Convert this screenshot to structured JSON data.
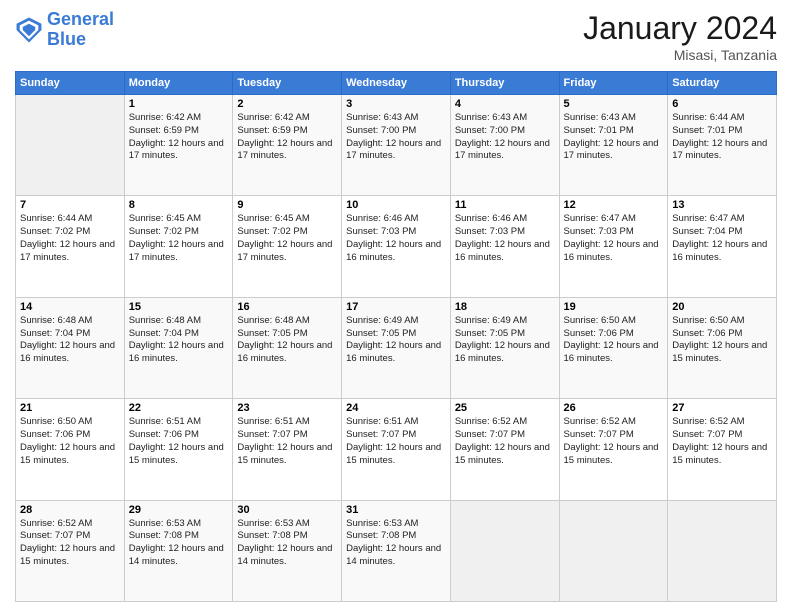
{
  "header": {
    "logo_line1": "General",
    "logo_line2": "Blue",
    "month_title": "January 2024",
    "location": "Misasi, Tanzania"
  },
  "weekdays": [
    "Sunday",
    "Monday",
    "Tuesday",
    "Wednesday",
    "Thursday",
    "Friday",
    "Saturday"
  ],
  "weeks": [
    [
      {
        "day": "",
        "sunrise": "",
        "sunset": "",
        "daylight": ""
      },
      {
        "day": "1",
        "sunrise": "Sunrise: 6:42 AM",
        "sunset": "Sunset: 6:59 PM",
        "daylight": "Daylight: 12 hours and 17 minutes."
      },
      {
        "day": "2",
        "sunrise": "Sunrise: 6:42 AM",
        "sunset": "Sunset: 6:59 PM",
        "daylight": "Daylight: 12 hours and 17 minutes."
      },
      {
        "day": "3",
        "sunrise": "Sunrise: 6:43 AM",
        "sunset": "Sunset: 7:00 PM",
        "daylight": "Daylight: 12 hours and 17 minutes."
      },
      {
        "day": "4",
        "sunrise": "Sunrise: 6:43 AM",
        "sunset": "Sunset: 7:00 PM",
        "daylight": "Daylight: 12 hours and 17 minutes."
      },
      {
        "day": "5",
        "sunrise": "Sunrise: 6:43 AM",
        "sunset": "Sunset: 7:01 PM",
        "daylight": "Daylight: 12 hours and 17 minutes."
      },
      {
        "day": "6",
        "sunrise": "Sunrise: 6:44 AM",
        "sunset": "Sunset: 7:01 PM",
        "daylight": "Daylight: 12 hours and 17 minutes."
      }
    ],
    [
      {
        "day": "7",
        "sunrise": "Sunrise: 6:44 AM",
        "sunset": "Sunset: 7:02 PM",
        "daylight": "Daylight: 12 hours and 17 minutes."
      },
      {
        "day": "8",
        "sunrise": "Sunrise: 6:45 AM",
        "sunset": "Sunset: 7:02 PM",
        "daylight": "Daylight: 12 hours and 17 minutes."
      },
      {
        "day": "9",
        "sunrise": "Sunrise: 6:45 AM",
        "sunset": "Sunset: 7:02 PM",
        "daylight": "Daylight: 12 hours and 17 minutes."
      },
      {
        "day": "10",
        "sunrise": "Sunrise: 6:46 AM",
        "sunset": "Sunset: 7:03 PM",
        "daylight": "Daylight: 12 hours and 16 minutes."
      },
      {
        "day": "11",
        "sunrise": "Sunrise: 6:46 AM",
        "sunset": "Sunset: 7:03 PM",
        "daylight": "Daylight: 12 hours and 16 minutes."
      },
      {
        "day": "12",
        "sunrise": "Sunrise: 6:47 AM",
        "sunset": "Sunset: 7:03 PM",
        "daylight": "Daylight: 12 hours and 16 minutes."
      },
      {
        "day": "13",
        "sunrise": "Sunrise: 6:47 AM",
        "sunset": "Sunset: 7:04 PM",
        "daylight": "Daylight: 12 hours and 16 minutes."
      }
    ],
    [
      {
        "day": "14",
        "sunrise": "Sunrise: 6:48 AM",
        "sunset": "Sunset: 7:04 PM",
        "daylight": "Daylight: 12 hours and 16 minutes."
      },
      {
        "day": "15",
        "sunrise": "Sunrise: 6:48 AM",
        "sunset": "Sunset: 7:04 PM",
        "daylight": "Daylight: 12 hours and 16 minutes."
      },
      {
        "day": "16",
        "sunrise": "Sunrise: 6:48 AM",
        "sunset": "Sunset: 7:05 PM",
        "daylight": "Daylight: 12 hours and 16 minutes."
      },
      {
        "day": "17",
        "sunrise": "Sunrise: 6:49 AM",
        "sunset": "Sunset: 7:05 PM",
        "daylight": "Daylight: 12 hours and 16 minutes."
      },
      {
        "day": "18",
        "sunrise": "Sunrise: 6:49 AM",
        "sunset": "Sunset: 7:05 PM",
        "daylight": "Daylight: 12 hours and 16 minutes."
      },
      {
        "day": "19",
        "sunrise": "Sunrise: 6:50 AM",
        "sunset": "Sunset: 7:06 PM",
        "daylight": "Daylight: 12 hours and 16 minutes."
      },
      {
        "day": "20",
        "sunrise": "Sunrise: 6:50 AM",
        "sunset": "Sunset: 7:06 PM",
        "daylight": "Daylight: 12 hours and 15 minutes."
      }
    ],
    [
      {
        "day": "21",
        "sunrise": "Sunrise: 6:50 AM",
        "sunset": "Sunset: 7:06 PM",
        "daylight": "Daylight: 12 hours and 15 minutes."
      },
      {
        "day": "22",
        "sunrise": "Sunrise: 6:51 AM",
        "sunset": "Sunset: 7:06 PM",
        "daylight": "Daylight: 12 hours and 15 minutes."
      },
      {
        "day": "23",
        "sunrise": "Sunrise: 6:51 AM",
        "sunset": "Sunset: 7:07 PM",
        "daylight": "Daylight: 12 hours and 15 minutes."
      },
      {
        "day": "24",
        "sunrise": "Sunrise: 6:51 AM",
        "sunset": "Sunset: 7:07 PM",
        "daylight": "Daylight: 12 hours and 15 minutes."
      },
      {
        "day": "25",
        "sunrise": "Sunrise: 6:52 AM",
        "sunset": "Sunset: 7:07 PM",
        "daylight": "Daylight: 12 hours and 15 minutes."
      },
      {
        "day": "26",
        "sunrise": "Sunrise: 6:52 AM",
        "sunset": "Sunset: 7:07 PM",
        "daylight": "Daylight: 12 hours and 15 minutes."
      },
      {
        "day": "27",
        "sunrise": "Sunrise: 6:52 AM",
        "sunset": "Sunset: 7:07 PM",
        "daylight": "Daylight: 12 hours and 15 minutes."
      }
    ],
    [
      {
        "day": "28",
        "sunrise": "Sunrise: 6:52 AM",
        "sunset": "Sunset: 7:07 PM",
        "daylight": "Daylight: 12 hours and 15 minutes."
      },
      {
        "day": "29",
        "sunrise": "Sunrise: 6:53 AM",
        "sunset": "Sunset: 7:08 PM",
        "daylight": "Daylight: 12 hours and 14 minutes."
      },
      {
        "day": "30",
        "sunrise": "Sunrise: 6:53 AM",
        "sunset": "Sunset: 7:08 PM",
        "daylight": "Daylight: 12 hours and 14 minutes."
      },
      {
        "day": "31",
        "sunrise": "Sunrise: 6:53 AM",
        "sunset": "Sunset: 7:08 PM",
        "daylight": "Daylight: 12 hours and 14 minutes."
      },
      {
        "day": "",
        "sunrise": "",
        "sunset": "",
        "daylight": ""
      },
      {
        "day": "",
        "sunrise": "",
        "sunset": "",
        "daylight": ""
      },
      {
        "day": "",
        "sunrise": "",
        "sunset": "",
        "daylight": ""
      }
    ]
  ]
}
